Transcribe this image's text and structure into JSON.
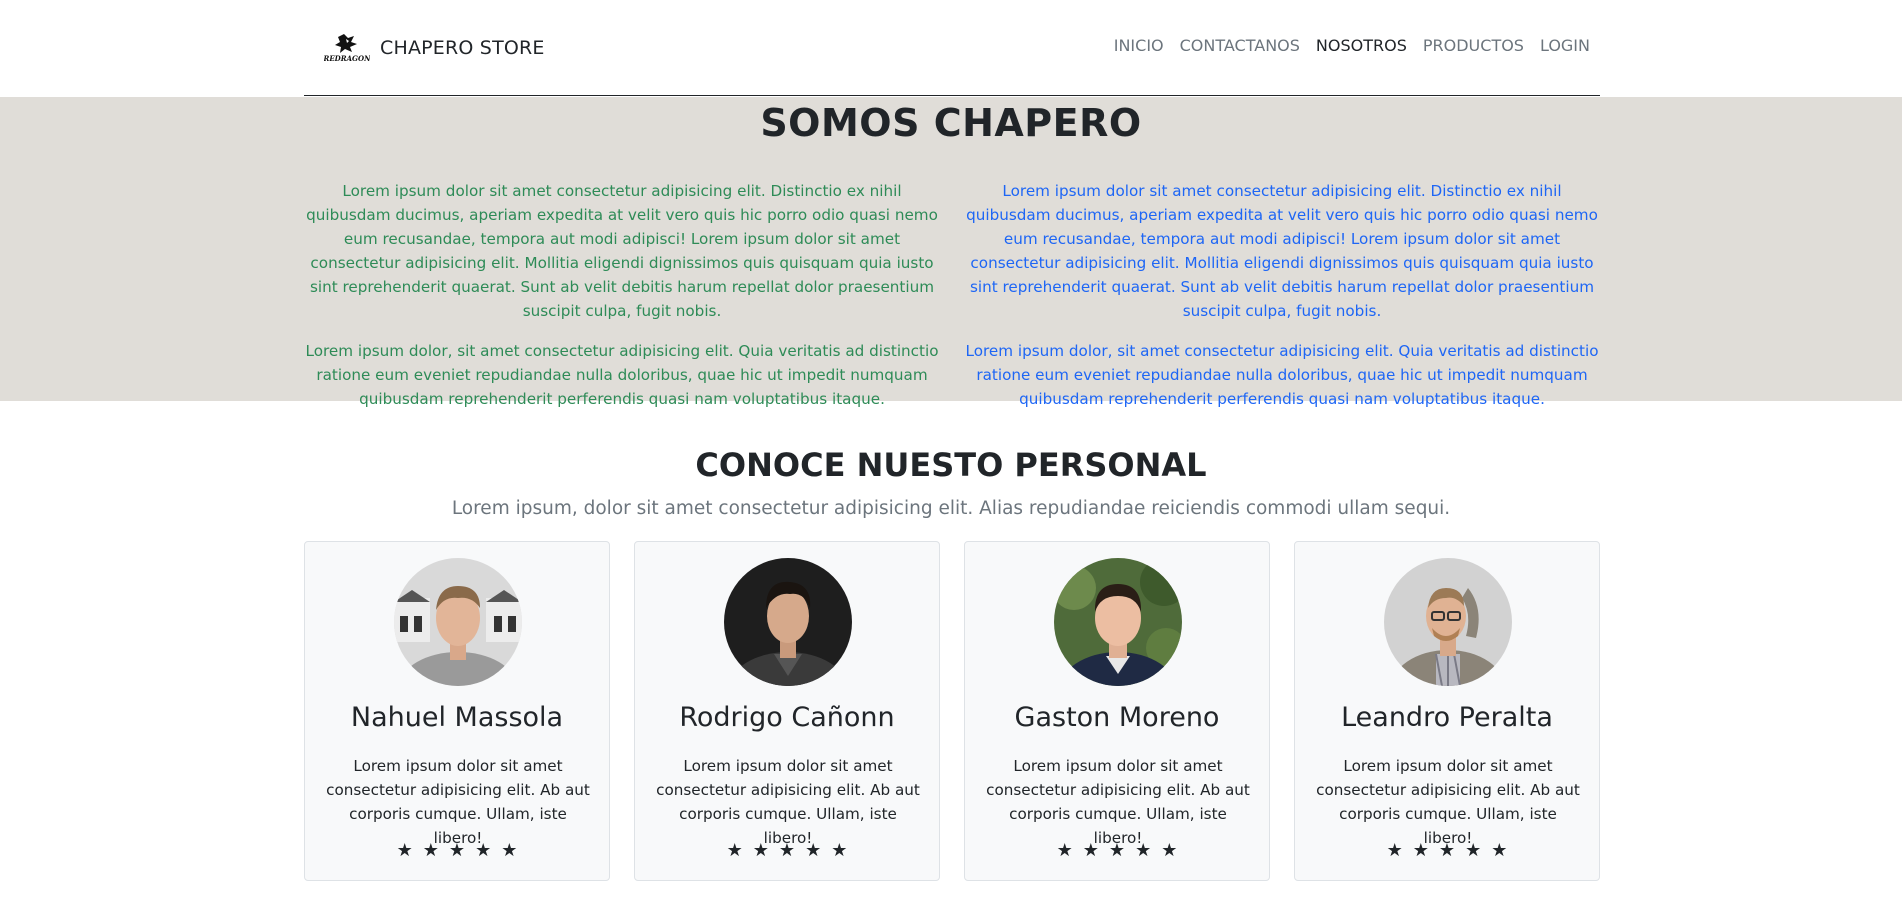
{
  "navbar": {
    "brand_name": "CHAPERO STORE",
    "logo_icon": "dragon-logo-icon",
    "logo_text": "REDRAGON",
    "links": [
      "INICIO",
      "CONTACTANOS",
      "NOSOTROS",
      "PRODUCTOS",
      "LOGIN"
    ],
    "active_link": "NOSOTROS"
  },
  "about": {
    "title": "SOMOS CHAPERO",
    "left_color": "#2e8b57",
    "right_color": "#1e66f5",
    "left": {
      "p1": "Lorem ipsum dolor sit amet consectetur adipisicing elit. Distinctio ex nihil quibusdam ducimus, aperiam expedita at velit vero quis hic porro odio quasi nemo eum recusandae, tempora aut modi adipisci! Lorem ipsum dolor sit amet consectetur adipisicing elit. Mollitia eligendi dignissimos quis quisquam quia iusto sint reprehenderit quaerat. Sunt ab velit debitis harum repellat dolor praesentium suscipit culpa, fugit nobis.",
      "p2": "Lorem ipsum dolor, sit amet consectetur adipisicing elit. Quia veritatis ad distinctio ratione eum eveniet repudiandae nulla doloribus, quae hic ut impedit numquam quibusdam reprehenderit perferendis quasi nam voluptatibus itaque."
    },
    "right": {
      "p1": "Lorem ipsum dolor sit amet consectetur adipisicing elit. Distinctio ex nihil quibusdam ducimus, aperiam expedita at velit vero quis hic porro odio quasi nemo eum recusandae, tempora aut modi adipisci! Lorem ipsum dolor sit amet consectetur adipisicing elit. Mollitia eligendi dignissimos quis quisquam quia iusto sint reprehenderit quaerat. Sunt ab velit debitis harum repellat dolor praesentium suscipit culpa, fugit nobis.",
      "p2": "Lorem ipsum dolor, sit amet consectetur adipisicing elit. Quia veritatis ad distinctio ratione eum eveniet repudiandae nulla doloribus, quae hic ut impedit numquam quibusdam reprehenderit perferendis quasi nam voluptatibus itaque."
    }
  },
  "team": {
    "title": "CONOCE NUESTO PERSONAL",
    "subtitle": "Lorem ipsum, dolor sit amet consectetur adipisicing elit. Alias repudiandae reiciendis commodi ullam sequi.",
    "members": [
      {
        "name": "Nahuel Massola",
        "text": "Lorem ipsum dolor sit amet consectetur adipisicing elit. Ab aut corporis cumque. Ullam, iste libero!",
        "stars": "★★★★★",
        "rating": 5
      },
      {
        "name": "Rodrigo Cañonn",
        "text": "Lorem ipsum dolor sit amet consectetur adipisicing elit. Ab aut corporis cumque. Ullam, iste libero!",
        "stars": "★★★★★",
        "rating": 5
      },
      {
        "name": "Gaston Moreno",
        "text": "Lorem ipsum dolor sit amet consectetur adipisicing elit. Ab aut corporis cumque. Ullam, iste libero!",
        "stars": "★★★★★",
        "rating": 5
      },
      {
        "name": "Leandro Peralta",
        "text": "Lorem ipsum dolor sit amet consectetur adipisicing elit. Ab aut corporis cumque. Ullam, iste libero!",
        "stars": "★★★★★",
        "rating": 5
      }
    ]
  }
}
